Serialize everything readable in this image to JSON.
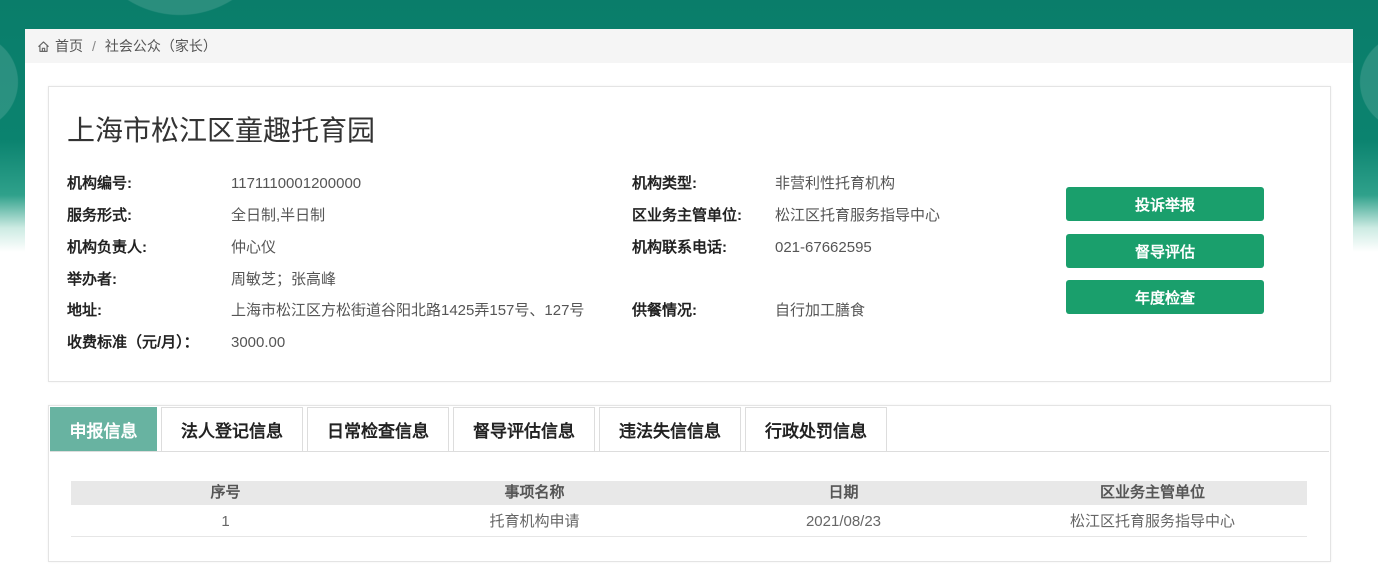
{
  "colors": {
    "header_teal": "#0a7d6a",
    "primary_button": "#1a9f6c",
    "active_tab": "#68b3a1",
    "table_header_bg": "#e8e8e8"
  },
  "icons": {
    "home": "home-icon"
  },
  "breadcrumb": {
    "home_label": "首页",
    "separator": "/",
    "current": "社会公众（家长）"
  },
  "institution": {
    "name": "上海市松江区童趣托育园",
    "info_rows": [
      {
        "left": {
          "label": "机构编号:",
          "value": "1171110001200000"
        },
        "right": {
          "label": "机构类型:",
          "value": "非营利性托育机构"
        }
      },
      {
        "left": {
          "label": "服务形式:",
          "value": "全日制,半日制"
        },
        "right": {
          "label": "区业务主管单位:",
          "value": "松江区托育服务指导中心"
        }
      },
      {
        "left": {
          "label": "机构负责人:",
          "value": "仲心仪"
        },
        "right": {
          "label": "机构联系电话:",
          "value": "021-67662595"
        }
      },
      {
        "left": {
          "label": "举办者:",
          "value": "周敏芝；张高峰"
        }
      },
      {
        "left": {
          "label": "地址:",
          "value": "上海市松江区方松街道谷阳北路1425弄157号、127号"
        },
        "right": {
          "label": "供餐情况:",
          "value": "自行加工膳食"
        }
      },
      {
        "left": {
          "label": "收费标准（元/月）：",
          "value": "3000.00"
        }
      }
    ]
  },
  "actions": {
    "complaint": "投诉举报",
    "supervision": "督导评估",
    "annual_check": "年度检查"
  },
  "tabs": [
    {
      "label": "申报信息",
      "active": true
    },
    {
      "label": "法人登记信息",
      "active": false
    },
    {
      "label": "日常检查信息",
      "active": false
    },
    {
      "label": "督导评估信息",
      "active": false
    },
    {
      "label": "违法失信信息",
      "active": false
    },
    {
      "label": "行政处罚信息",
      "active": false
    }
  ],
  "table": {
    "headers": [
      "序号",
      "事项名称",
      "日期",
      "区业务主管单位"
    ],
    "rows": [
      [
        "1",
        "托育机构申请",
        "2021/08/23",
        "松江区托育服务指导中心"
      ]
    ]
  }
}
